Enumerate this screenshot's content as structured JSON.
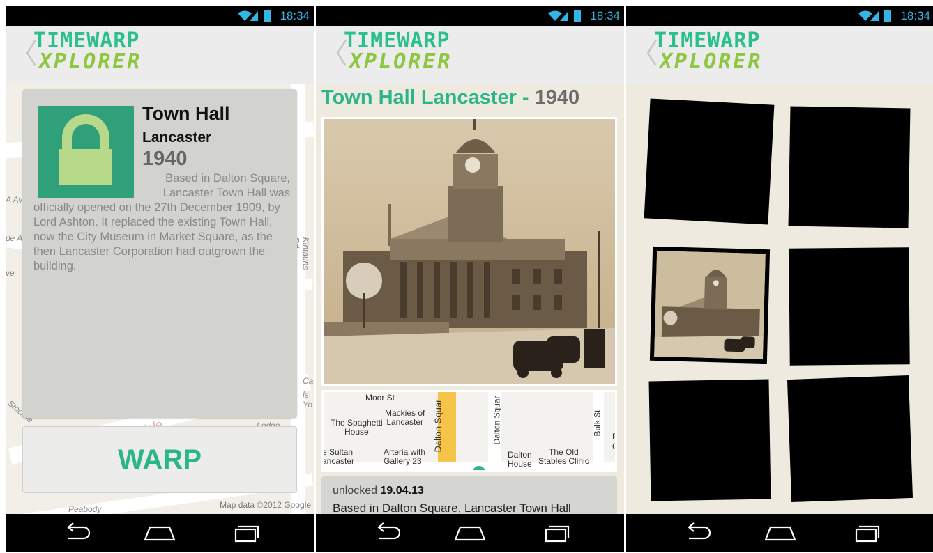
{
  "status": {
    "time": "18:34"
  },
  "logo": {
    "line1": "TIMEWARP",
    "line2": "XPLORER"
  },
  "screen1": {
    "card": {
      "title": "Town Hall",
      "subtitle": "Lancaster",
      "year": "1940",
      "description_part1": "Based in Dalton Square, Lancaster Town Hall was",
      "description_part2": "officially opened on the 27th December 1909, by Lord Ashton. It replaced the existing Town Hall, now the City Museum in Market Square, as the then Lancaster Corporation had outgrown the building."
    },
    "warp_label": "WARP",
    "map_credit": "Map data ©2012 Google",
    "map_labels": [
      "A Av",
      "de A",
      "ve",
      "Kintauns Rd",
      "Lodge",
      "Vale",
      "Peabody",
      "Ca",
      "ls Yo",
      "Stockfie"
    ]
  },
  "screen2": {
    "title_place": "Town Hall Lancaster",
    "title_sep": " - ",
    "title_year": "1940",
    "map_labels": {
      "moor_st": "Moor St",
      "mackies": "Mackies of\nLancaster",
      "spaghetti": "The Spaghetti\nHouse",
      "dalton_square_vertical": "Dalton Squar",
      "dalton_square_vertical2": "Dalton Squar",
      "bulk_st": "Bulk St",
      "sultan": "e Sultan\nancaster",
      "arteria": "Arteria with\nGallery 23",
      "dalton_house": "Dalton\nHouse",
      "old_stables": "The Old\nStables Clinic",
      "edge_f": "F",
      "edge_c": "C"
    },
    "unlocked_label": "unlocked",
    "unlocked_date": "19.04.13",
    "description": "Based in Dalton Square, Lancaster Town Hall"
  },
  "colors": {
    "accent_green": "#2bb58a",
    "logo_lime": "#8ec63f",
    "status_blue": "#33b5e5"
  },
  "icons": [
    "wifi-icon",
    "signal-icon",
    "battery-icon",
    "back-chevron-icon",
    "lock-icon",
    "nav-back-icon",
    "nav-home-icon",
    "nav-recents-icon"
  ]
}
